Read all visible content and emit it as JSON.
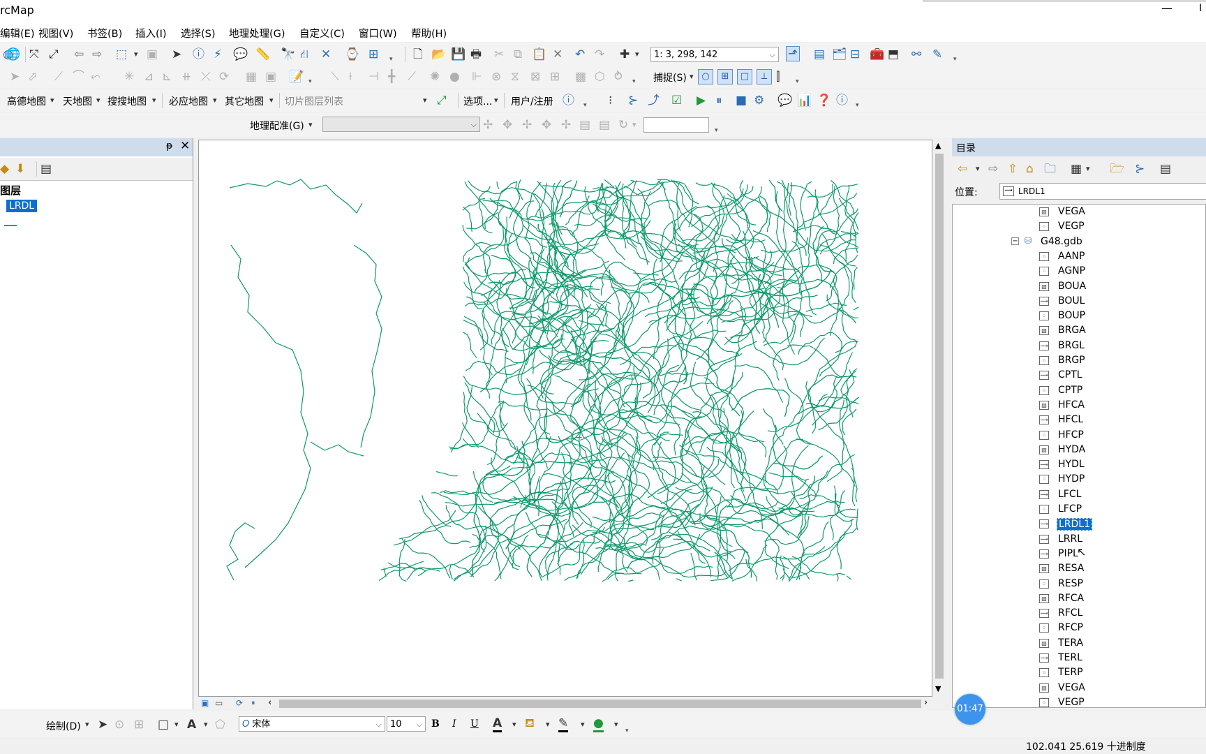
{
  "window": {
    "title": "rcMap",
    "minimize": "—",
    "close": "I"
  },
  "menu": [
    "编辑(E)",
    "视图(V)",
    "书签(B)",
    "插入(I)",
    "选择(S)",
    "地理处理(G)",
    "自定义(C)",
    "窗口(W)",
    "帮助(H)"
  ],
  "toolbar": {
    "scale_value": "1: 3, 298, 142",
    "snapping_label": "捕捉(S)",
    "basemaps": [
      "高德地图",
      "天地图",
      "搜搜地图",
      "必应地图",
      "其它地图"
    ],
    "tile_list_placeholder": "切片图层列表",
    "options_label": "选项...",
    "user_register_label": "用户/注册",
    "georef_label": "地理配准(G)"
  },
  "toc": {
    "title": "图层",
    "layer_name": "LRDL",
    "pin": "ᵽ",
    "close": "✕"
  },
  "catalog": {
    "title": "目录",
    "location_label": "位置:",
    "location_value": "LRDL1",
    "items": [
      {
        "name": "VEGA",
        "kind": "polygon",
        "indent": 2
      },
      {
        "name": "VEGP",
        "kind": "point",
        "indent": 2
      },
      {
        "name": "G48.gdb",
        "kind": "gdb",
        "indent": 1
      },
      {
        "name": "AANP",
        "kind": "point",
        "indent": 2
      },
      {
        "name": "AGNP",
        "kind": "point",
        "indent": 2
      },
      {
        "name": "BOUA",
        "kind": "polygon",
        "indent": 2
      },
      {
        "name": "BOUL",
        "kind": "line",
        "indent": 2
      },
      {
        "name": "BOUP",
        "kind": "point",
        "indent": 2
      },
      {
        "name": "BRGA",
        "kind": "polygon",
        "indent": 2
      },
      {
        "name": "BRGL",
        "kind": "line",
        "indent": 2
      },
      {
        "name": "BRGP",
        "kind": "point",
        "indent": 2
      },
      {
        "name": "CPTL",
        "kind": "line",
        "indent": 2
      },
      {
        "name": "CPTP",
        "kind": "point",
        "indent": 2
      },
      {
        "name": "HFCA",
        "kind": "polygon",
        "indent": 2
      },
      {
        "name": "HFCL",
        "kind": "line",
        "indent": 2
      },
      {
        "name": "HFCP",
        "kind": "point",
        "indent": 2
      },
      {
        "name": "HYDA",
        "kind": "polygon",
        "indent": 2
      },
      {
        "name": "HYDL",
        "kind": "line",
        "indent": 2
      },
      {
        "name": "HYDP",
        "kind": "point",
        "indent": 2
      },
      {
        "name": "LFCL",
        "kind": "line",
        "indent": 2
      },
      {
        "name": "LFCP",
        "kind": "point",
        "indent": 2
      },
      {
        "name": "LRDL1",
        "kind": "line",
        "indent": 2,
        "selected": true
      },
      {
        "name": "LRRL",
        "kind": "line",
        "indent": 2
      },
      {
        "name": "PIPL",
        "kind": "line",
        "indent": 2
      },
      {
        "name": "RESA",
        "kind": "polygon",
        "indent": 2
      },
      {
        "name": "RESP",
        "kind": "point",
        "indent": 2
      },
      {
        "name": "RFCA",
        "kind": "polygon",
        "indent": 2
      },
      {
        "name": "RFCL",
        "kind": "line",
        "indent": 2
      },
      {
        "name": "RFCP",
        "kind": "point",
        "indent": 2
      },
      {
        "name": "TERA",
        "kind": "polygon",
        "indent": 2
      },
      {
        "name": "TERL",
        "kind": "line",
        "indent": 2
      },
      {
        "name": "TERP",
        "kind": "point",
        "indent": 2
      },
      {
        "name": "VEGA",
        "kind": "polygon",
        "indent": 2
      },
      {
        "name": "VEGP",
        "kind": "point",
        "indent": 2
      }
    ]
  },
  "draw": {
    "draw_label": "绘制(D)",
    "font_name": "宋体",
    "font_size": "10",
    "bold": "B",
    "italic": "I",
    "underline": "U"
  },
  "status": {
    "coordinates": "102.041  25.619 十进制度"
  },
  "overlay": {
    "timer": "01:47"
  },
  "colors": {
    "road_line": "#0e9a6a",
    "selection": "#0b6fd1",
    "panel_header": "#cfdcec"
  }
}
